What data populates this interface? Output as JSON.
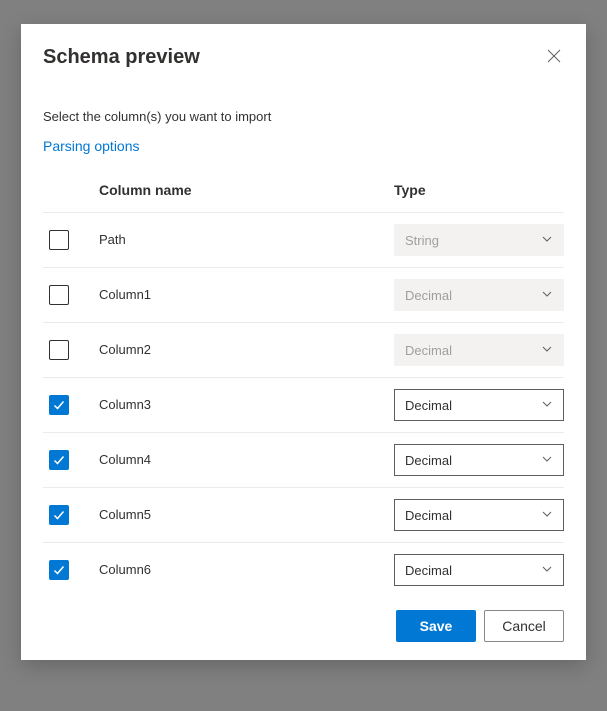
{
  "title": "Schema preview",
  "subtitle": "Select the column(s) you want to import",
  "parsing_link": "Parsing options",
  "headers": {
    "name": "Column name",
    "type": "Type"
  },
  "rows": [
    {
      "checked": false,
      "name": "Path",
      "type": "String",
      "enabled": false
    },
    {
      "checked": false,
      "name": "Column1",
      "type": "Decimal",
      "enabled": false
    },
    {
      "checked": false,
      "name": "Column2",
      "type": "Decimal",
      "enabled": false
    },
    {
      "checked": true,
      "name": "Column3",
      "type": "Decimal",
      "enabled": true
    },
    {
      "checked": true,
      "name": "Column4",
      "type": "Decimal",
      "enabled": true
    },
    {
      "checked": true,
      "name": "Column5",
      "type": "Decimal",
      "enabled": true
    },
    {
      "checked": true,
      "name": "Column6",
      "type": "Decimal",
      "enabled": true
    }
  ],
  "buttons": {
    "save": "Save",
    "cancel": "Cancel"
  }
}
